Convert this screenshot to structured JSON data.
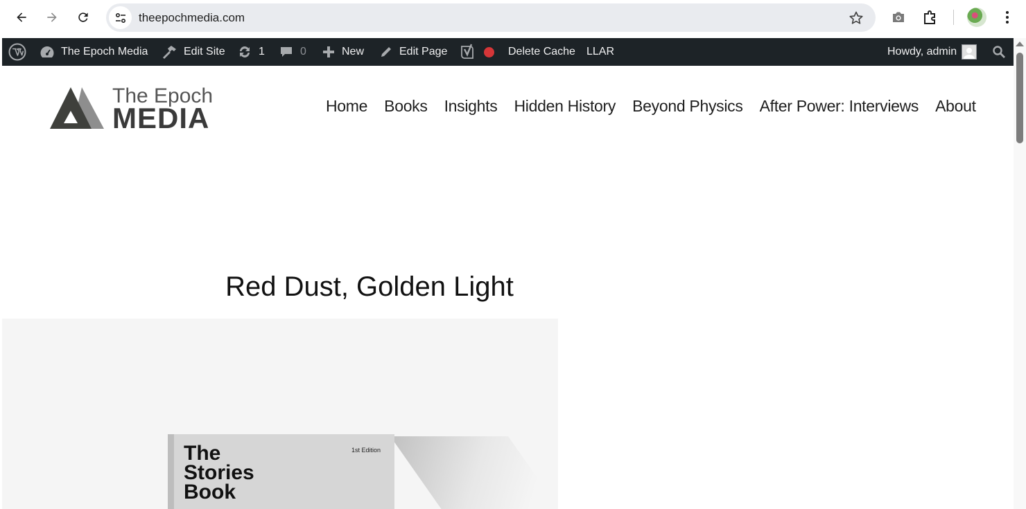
{
  "browser": {
    "url": "theepochmedia.com"
  },
  "adminbar": {
    "site_name": "The Epoch Media",
    "edit_site": "Edit Site",
    "updates_count": "1",
    "comments_count": "0",
    "new_label": "New",
    "edit_page": "Edit Page",
    "delete_cache": "Delete Cache",
    "llar": "LLAR",
    "howdy": "Howdy, admin"
  },
  "site": {
    "logo_top": "The Epoch",
    "logo_bottom": "MEDIA",
    "nav": [
      "Home",
      "Books",
      "Insights",
      "Hidden History",
      "Beyond Physics",
      "After Power: Interviews",
      "About"
    ]
  },
  "page": {
    "title": "Red Dust, Golden Light",
    "book_title": "The Stories Book",
    "book_title_lines": [
      "The",
      "Stories",
      "Book"
    ],
    "book_edition": "1st Edition"
  },
  "colors": {
    "adminbar_bg": "#1d2327",
    "status_dot": "#d63638",
    "hero_bg": "#f5f5f5"
  }
}
